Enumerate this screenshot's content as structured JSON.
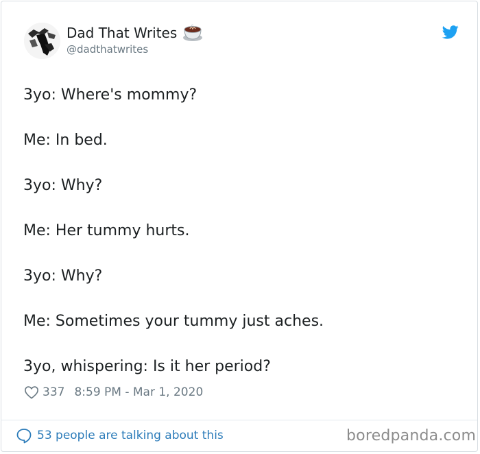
{
  "tweet": {
    "display_name": "Dad That Writes",
    "handle": "@dadthatwrites",
    "emoji_icon": "hot-beverage-icon",
    "platform_icon": "twitter-bird-icon",
    "lines": [
      "3yo: Where's mommy?",
      "Me: In bed.",
      "3yo: Why?",
      "Me: Her tummy hurts.",
      "3yo: Why?",
      "Me: Sometimes your tummy just aches.",
      "3yo, whispering: Is it her period?"
    ],
    "likes": "337",
    "timestamp": "8:59 PM - Mar 1, 2020",
    "conversation_link": "53 people are talking about this"
  },
  "watermark": "boredpanda.com",
  "colors": {
    "text": "#1c2022",
    "muted": "#697882",
    "link": "#2b7bb9",
    "twitter_blue": "#1da1f2",
    "border": "#d7dde2"
  }
}
